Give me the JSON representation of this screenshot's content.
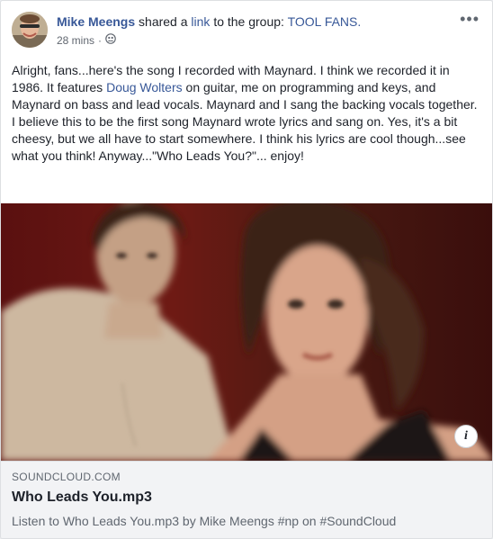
{
  "post": {
    "author": "Mike Meengs",
    "action_prefix": "shared a",
    "action_link": "link",
    "action_suffix": "to the group:",
    "group": "TOOL FANS.",
    "time": "28 mins",
    "privacy_icon": "group-icon",
    "more_label": "•••",
    "text_before": "Alright, fans...here's the song I recorded with Maynard. I think we recorded it in 1986. It features ",
    "mention": "Doug Wolters",
    "text_after": " on guitar, me on programming and keys, and Maynard on bass and lead vocals. Maynard and I sang the backing vocals together. I believe this to be the first song Maynard wrote lyrics and sang on. Yes, it's a bit cheesy, but we all have to start somewhere. I think his lyrics are cool though...see what you think! Anyway...\"Who Leads You?\"... enjoy!"
  },
  "attachment": {
    "info_label": "i",
    "domain": "SOUNDCLOUD.COM",
    "title": "Who Leads You.mp3",
    "description": "Listen to Who Leads You.mp3 by Mike Meengs #np on #SoundCloud"
  },
  "colors": {
    "link": "#385898",
    "text": "#1d2129",
    "muted": "#606770"
  }
}
